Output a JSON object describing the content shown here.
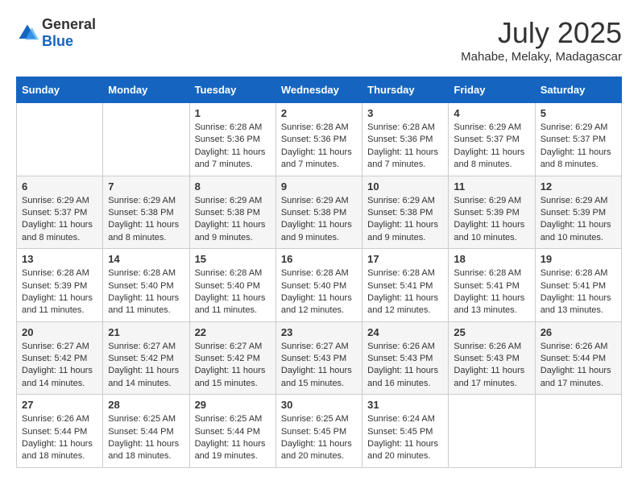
{
  "logo": {
    "text_general": "General",
    "text_blue": "Blue"
  },
  "title": "July 2025",
  "subtitle": "Mahabe, Melaky, Madagascar",
  "days_of_week": [
    "Sunday",
    "Monday",
    "Tuesday",
    "Wednesday",
    "Thursday",
    "Friday",
    "Saturday"
  ],
  "weeks": [
    [
      {
        "day": "",
        "info": ""
      },
      {
        "day": "",
        "info": ""
      },
      {
        "day": "1",
        "info": "Sunrise: 6:28 AM\nSunset: 5:36 PM\nDaylight: 11 hours and 7 minutes."
      },
      {
        "day": "2",
        "info": "Sunrise: 6:28 AM\nSunset: 5:36 PM\nDaylight: 11 hours and 7 minutes."
      },
      {
        "day": "3",
        "info": "Sunrise: 6:28 AM\nSunset: 5:36 PM\nDaylight: 11 hours and 7 minutes."
      },
      {
        "day": "4",
        "info": "Sunrise: 6:29 AM\nSunset: 5:37 PM\nDaylight: 11 hours and 8 minutes."
      },
      {
        "day": "5",
        "info": "Sunrise: 6:29 AM\nSunset: 5:37 PM\nDaylight: 11 hours and 8 minutes."
      }
    ],
    [
      {
        "day": "6",
        "info": "Sunrise: 6:29 AM\nSunset: 5:37 PM\nDaylight: 11 hours and 8 minutes."
      },
      {
        "day": "7",
        "info": "Sunrise: 6:29 AM\nSunset: 5:38 PM\nDaylight: 11 hours and 8 minutes."
      },
      {
        "day": "8",
        "info": "Sunrise: 6:29 AM\nSunset: 5:38 PM\nDaylight: 11 hours and 9 minutes."
      },
      {
        "day": "9",
        "info": "Sunrise: 6:29 AM\nSunset: 5:38 PM\nDaylight: 11 hours and 9 minutes."
      },
      {
        "day": "10",
        "info": "Sunrise: 6:29 AM\nSunset: 5:38 PM\nDaylight: 11 hours and 9 minutes."
      },
      {
        "day": "11",
        "info": "Sunrise: 6:29 AM\nSunset: 5:39 PM\nDaylight: 11 hours and 10 minutes."
      },
      {
        "day": "12",
        "info": "Sunrise: 6:29 AM\nSunset: 5:39 PM\nDaylight: 11 hours and 10 minutes."
      }
    ],
    [
      {
        "day": "13",
        "info": "Sunrise: 6:28 AM\nSunset: 5:39 PM\nDaylight: 11 hours and 11 minutes."
      },
      {
        "day": "14",
        "info": "Sunrise: 6:28 AM\nSunset: 5:40 PM\nDaylight: 11 hours and 11 minutes."
      },
      {
        "day": "15",
        "info": "Sunrise: 6:28 AM\nSunset: 5:40 PM\nDaylight: 11 hours and 11 minutes."
      },
      {
        "day": "16",
        "info": "Sunrise: 6:28 AM\nSunset: 5:40 PM\nDaylight: 11 hours and 12 minutes."
      },
      {
        "day": "17",
        "info": "Sunrise: 6:28 AM\nSunset: 5:41 PM\nDaylight: 11 hours and 12 minutes."
      },
      {
        "day": "18",
        "info": "Sunrise: 6:28 AM\nSunset: 5:41 PM\nDaylight: 11 hours and 13 minutes."
      },
      {
        "day": "19",
        "info": "Sunrise: 6:28 AM\nSunset: 5:41 PM\nDaylight: 11 hours and 13 minutes."
      }
    ],
    [
      {
        "day": "20",
        "info": "Sunrise: 6:27 AM\nSunset: 5:42 PM\nDaylight: 11 hours and 14 minutes."
      },
      {
        "day": "21",
        "info": "Sunrise: 6:27 AM\nSunset: 5:42 PM\nDaylight: 11 hours and 14 minutes."
      },
      {
        "day": "22",
        "info": "Sunrise: 6:27 AM\nSunset: 5:42 PM\nDaylight: 11 hours and 15 minutes."
      },
      {
        "day": "23",
        "info": "Sunrise: 6:27 AM\nSunset: 5:43 PM\nDaylight: 11 hours and 15 minutes."
      },
      {
        "day": "24",
        "info": "Sunrise: 6:26 AM\nSunset: 5:43 PM\nDaylight: 11 hours and 16 minutes."
      },
      {
        "day": "25",
        "info": "Sunrise: 6:26 AM\nSunset: 5:43 PM\nDaylight: 11 hours and 17 minutes."
      },
      {
        "day": "26",
        "info": "Sunrise: 6:26 AM\nSunset: 5:44 PM\nDaylight: 11 hours and 17 minutes."
      }
    ],
    [
      {
        "day": "27",
        "info": "Sunrise: 6:26 AM\nSunset: 5:44 PM\nDaylight: 11 hours and 18 minutes."
      },
      {
        "day": "28",
        "info": "Sunrise: 6:25 AM\nSunset: 5:44 PM\nDaylight: 11 hours and 18 minutes."
      },
      {
        "day": "29",
        "info": "Sunrise: 6:25 AM\nSunset: 5:44 PM\nDaylight: 11 hours and 19 minutes."
      },
      {
        "day": "30",
        "info": "Sunrise: 6:25 AM\nSunset: 5:45 PM\nDaylight: 11 hours and 20 minutes."
      },
      {
        "day": "31",
        "info": "Sunrise: 6:24 AM\nSunset: 5:45 PM\nDaylight: 11 hours and 20 minutes."
      },
      {
        "day": "",
        "info": ""
      },
      {
        "day": "",
        "info": ""
      }
    ]
  ]
}
